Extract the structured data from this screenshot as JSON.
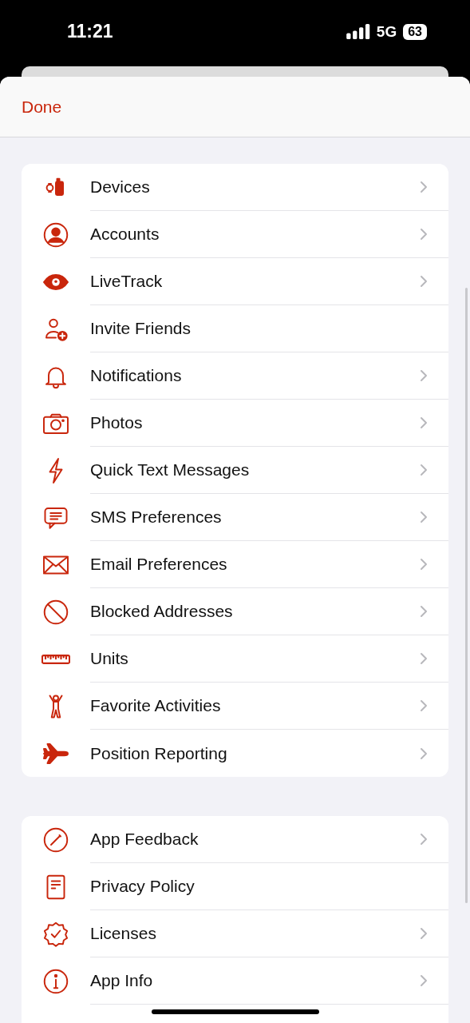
{
  "status_bar": {
    "time": "11:21",
    "network": "5G",
    "battery": "63"
  },
  "header": {
    "done": "Done"
  },
  "sections": [
    {
      "items": [
        {
          "label": "Devices",
          "chevron": true
        },
        {
          "label": "Accounts",
          "chevron": true
        },
        {
          "label": "LiveTrack",
          "chevron": true
        },
        {
          "label": "Invite Friends",
          "chevron": false
        },
        {
          "label": "Notifications",
          "chevron": true
        },
        {
          "label": "Photos",
          "chevron": true
        },
        {
          "label": "Quick Text Messages",
          "chevron": true
        },
        {
          "label": "SMS Preferences",
          "chevron": true
        },
        {
          "label": "Email Preferences",
          "chevron": true
        },
        {
          "label": "Blocked Addresses",
          "chevron": true
        },
        {
          "label": "Units",
          "chevron": true
        },
        {
          "label": "Favorite Activities",
          "chevron": true
        },
        {
          "label": "Position Reporting",
          "chevron": true
        }
      ]
    },
    {
      "items": [
        {
          "label": "App Feedback",
          "chevron": true
        },
        {
          "label": "Privacy Policy",
          "chevron": false
        },
        {
          "label": "Licenses",
          "chevron": true
        },
        {
          "label": "App Info",
          "chevron": true
        }
      ]
    }
  ]
}
